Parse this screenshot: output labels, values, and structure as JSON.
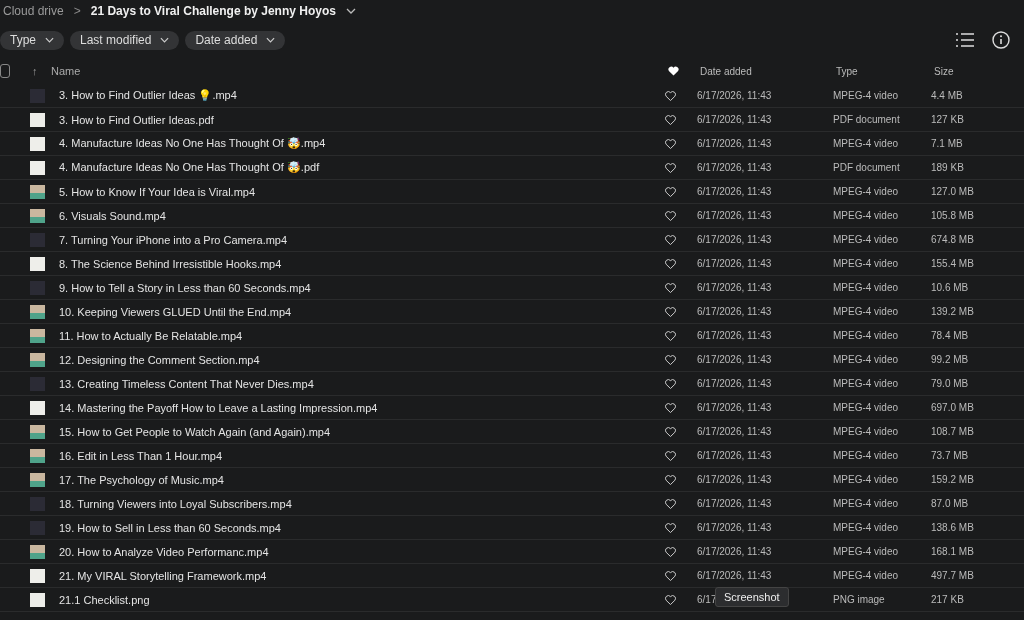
{
  "breadcrumb": {
    "root": "Cloud drive",
    "separator": ">",
    "current": "21 Days to Viral Challenge by Jenny Hoyos"
  },
  "filters": [
    {
      "label": "Type"
    },
    {
      "label": "Last modified"
    },
    {
      "label": "Date added"
    }
  ],
  "table": {
    "select_all": {
      "checked": false
    },
    "sort_arrow": "↑",
    "columns": [
      "Name",
      "Date added",
      "Type",
      "Size"
    ],
    "rows": [
      {
        "kind": "dark",
        "name": "3. How to Find Outlier Ideas 💡.mp4",
        "favorite": false,
        "date": "6/17/2026, 11:43",
        "type": "MPEG-4 video",
        "size": "4.4 MB"
      },
      {
        "kind": "document",
        "name": "3. How to Find Outlier Ideas.pdf",
        "favorite": false,
        "date": "6/17/2026, 11:43",
        "type": "PDF document",
        "size": "127 KB"
      },
      {
        "kind": "document",
        "name": "4. Manufacture Ideas No One Has Thought Of 🤯.mp4",
        "favorite": false,
        "date": "6/17/2026, 11:43",
        "type": "MPEG-4 video",
        "size": "7.1 MB"
      },
      {
        "kind": "document",
        "name": "4. Manufacture Ideas No One Has Thought Of 🤯.pdf",
        "favorite": false,
        "date": "6/17/2026, 11:43",
        "type": "PDF document",
        "size": "189 KB"
      },
      {
        "kind": "photo",
        "name": "5. How to Know If Your Idea is Viral.mp4",
        "favorite": false,
        "date": "6/17/2026, 11:43",
        "type": "MPEG-4 video",
        "size": "127.0 MB"
      },
      {
        "kind": "photo",
        "name": "6. Visuals Sound.mp4",
        "favorite": false,
        "date": "6/17/2026, 11:43",
        "type": "MPEG-4 video",
        "size": "105.8 MB"
      },
      {
        "kind": "dark",
        "name": "7. Turning Your iPhone into a Pro Camera.mp4",
        "favorite": false,
        "date": "6/17/2026, 11:43",
        "type": "MPEG-4 video",
        "size": "674.8 MB"
      },
      {
        "kind": "document",
        "name": "8. The Science Behind Irresistible Hooks.mp4",
        "favorite": false,
        "date": "6/17/2026, 11:43",
        "type": "MPEG-4 video",
        "size": "155.4 MB"
      },
      {
        "kind": "dark",
        "name": "9. How to Tell a Story in Less than 60 Seconds.mp4",
        "favorite": false,
        "date": "6/17/2026, 11:43",
        "type": "MPEG-4 video",
        "size": "10.6 MB"
      },
      {
        "kind": "photo",
        "name": "10. Keeping Viewers GLUED Until the End.mp4",
        "favorite": false,
        "date": "6/17/2026, 11:43",
        "type": "MPEG-4 video",
        "size": "139.2 MB"
      },
      {
        "kind": "photo",
        "name": "11. How to Actually Be Relatable.mp4",
        "favorite": false,
        "date": "6/17/2026, 11:43",
        "type": "MPEG-4 video",
        "size": "78.4 MB"
      },
      {
        "kind": "photo",
        "name": "12. Designing the Comment Section.mp4",
        "favorite": false,
        "date": "6/17/2026, 11:43",
        "type": "MPEG-4 video",
        "size": "99.2 MB"
      },
      {
        "kind": "dark",
        "name": "13. Creating Timeless Content That Never Dies.mp4",
        "favorite": false,
        "date": "6/17/2026, 11:43",
        "type": "MPEG-4 video",
        "size": "79.0 MB"
      },
      {
        "kind": "document",
        "name": "14. Mastering the Payoff How to Leave a Lasting Impression.mp4",
        "favorite": false,
        "date": "6/17/2026, 11:43",
        "type": "MPEG-4 video",
        "size": "697.0 MB"
      },
      {
        "kind": "photo",
        "name": "15. How to Get People to Watch Again (and Again).mp4",
        "favorite": false,
        "date": "6/17/2026, 11:43",
        "type": "MPEG-4 video",
        "size": "108.7 MB"
      },
      {
        "kind": "photo",
        "name": "16. Edit in Less Than 1 Hour.mp4",
        "favorite": false,
        "date": "6/17/2026, 11:43",
        "type": "MPEG-4 video",
        "size": "73.7 MB"
      },
      {
        "kind": "photo",
        "name": "17. The Psychology of Music.mp4",
        "favorite": false,
        "date": "6/17/2026, 11:43",
        "type": "MPEG-4 video",
        "size": "159.2 MB"
      },
      {
        "kind": "dark",
        "name": "18. Turning Viewers into Loyal Subscribers.mp4",
        "favorite": false,
        "date": "6/17/2026, 11:43",
        "type": "MPEG-4 video",
        "size": "87.0 MB"
      },
      {
        "kind": "dark",
        "name": "19. How to Sell in Less than 60 Seconds.mp4",
        "favorite": false,
        "date": "6/17/2026, 11:43",
        "type": "MPEG-4 video",
        "size": "138.6 MB"
      },
      {
        "kind": "photo",
        "name": "20. How to Analyze Video Performanc.mp4",
        "favorite": false,
        "date": "6/17/2026, 11:43",
        "type": "MPEG-4 video",
        "size": "168.1 MB"
      },
      {
        "kind": "document",
        "name": "21. My VIRAL Storytelling Framework.mp4",
        "favorite": false,
        "date": "6/17/2026, 11:43",
        "type": "MPEG-4 video",
        "size": "497.7 MB"
      },
      {
        "kind": "document",
        "name": "21.1 Checklist.png",
        "favorite": false,
        "date": "6/17",
        "type": "PNG image",
        "size": "217 KB",
        "tooltip": "Screenshot"
      }
    ]
  }
}
